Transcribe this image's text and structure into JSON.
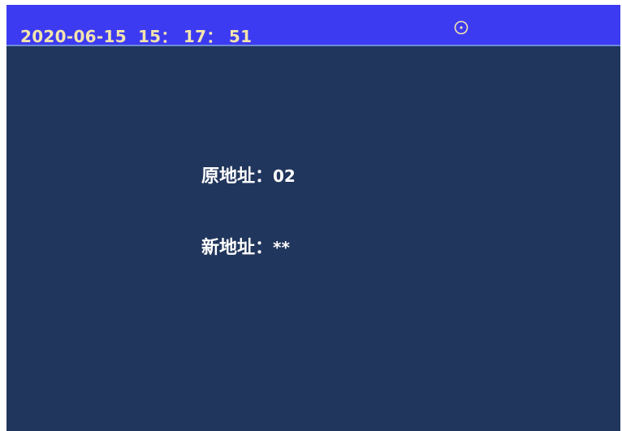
{
  "status_bar": {
    "date": "2020-06-15",
    "time": "15： 17： 51",
    "icon": "clock-icon",
    "colors": {
      "bar_background": "#3d3bf2",
      "text": "#f3e4ad"
    }
  },
  "address_form": {
    "old_address_label": "原地址：",
    "old_address_value": "02",
    "new_address_label": "新地址：",
    "new_address_value": "**"
  },
  "colors": {
    "screen_background": "#21365c",
    "form_text": "#ffffff"
  }
}
